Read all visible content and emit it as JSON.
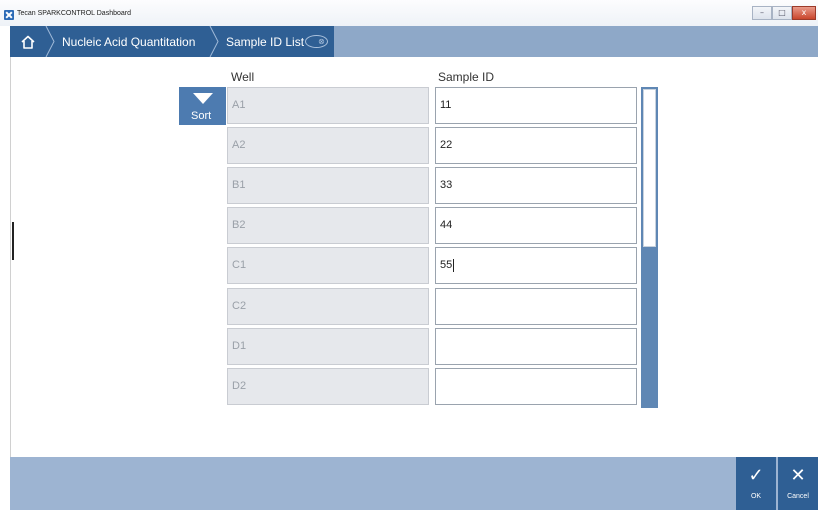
{
  "window": {
    "title": "Tecan SPARKCONTROL Dashboard",
    "min_glyph": "–",
    "max_glyph": "□",
    "close_glyph": "x"
  },
  "breadcrumb": {
    "home_icon": "home-icon",
    "items": [
      {
        "label": "Nucleic Acid Quantitation"
      },
      {
        "label": "Sample ID List"
      }
    ],
    "close_glyph": "⊗"
  },
  "table": {
    "headers": {
      "well": "Well",
      "sample_id": "Sample ID"
    },
    "sort_label": "Sort",
    "rows": [
      {
        "well": "A1",
        "sample_id": "11"
      },
      {
        "well": "A2",
        "sample_id": "22"
      },
      {
        "well": "B1",
        "sample_id": "33"
      },
      {
        "well": "B2",
        "sample_id": "44"
      },
      {
        "well": "C1",
        "sample_id": "55"
      },
      {
        "well": "C2",
        "sample_id": ""
      },
      {
        "well": "D1",
        "sample_id": ""
      },
      {
        "well": "D2",
        "sample_id": ""
      }
    ]
  },
  "footer": {
    "ok_label": "OK",
    "ok_glyph": "✓",
    "cancel_label": "Cancel",
    "cancel_glyph": "✕"
  },
  "colors": {
    "accent": "#2f5f94",
    "nav_bar": "#8ea8c8",
    "footer_bar": "#9db4d2",
    "scrollbar": "#5f87b4"
  }
}
